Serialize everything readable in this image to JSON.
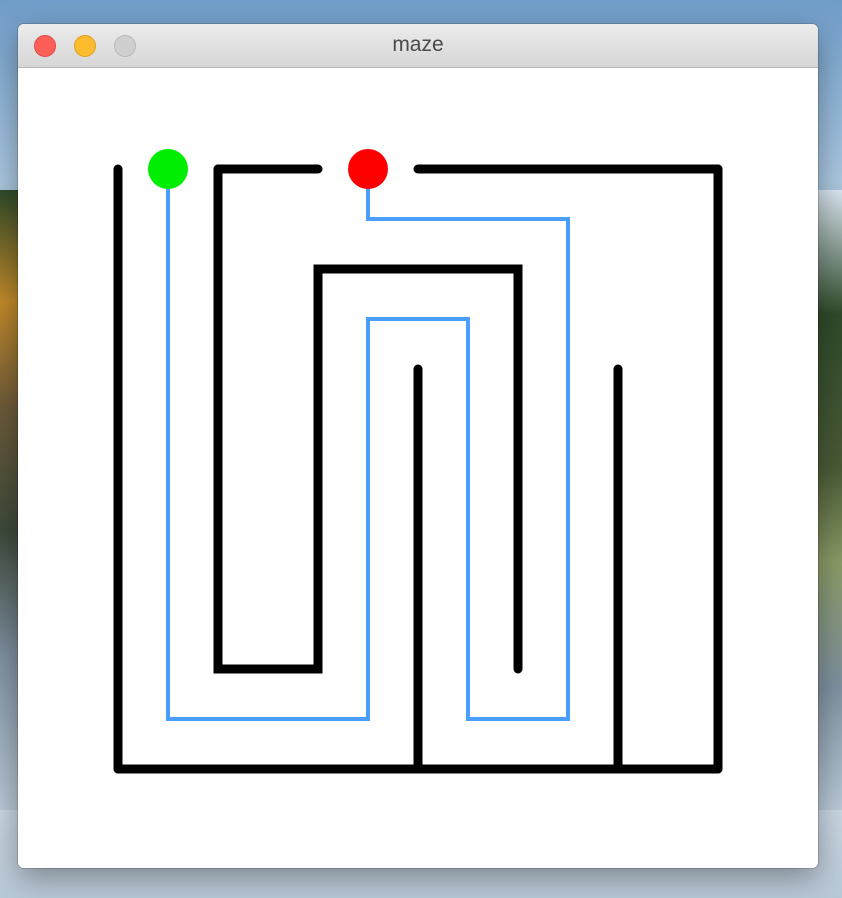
{
  "window": {
    "title": "maze"
  },
  "colors": {
    "wall": "#000000",
    "path": "#4a9eff",
    "start_marker": "#00ee00",
    "end_marker": "#ff0000",
    "background": "#ffffff"
  }
}
